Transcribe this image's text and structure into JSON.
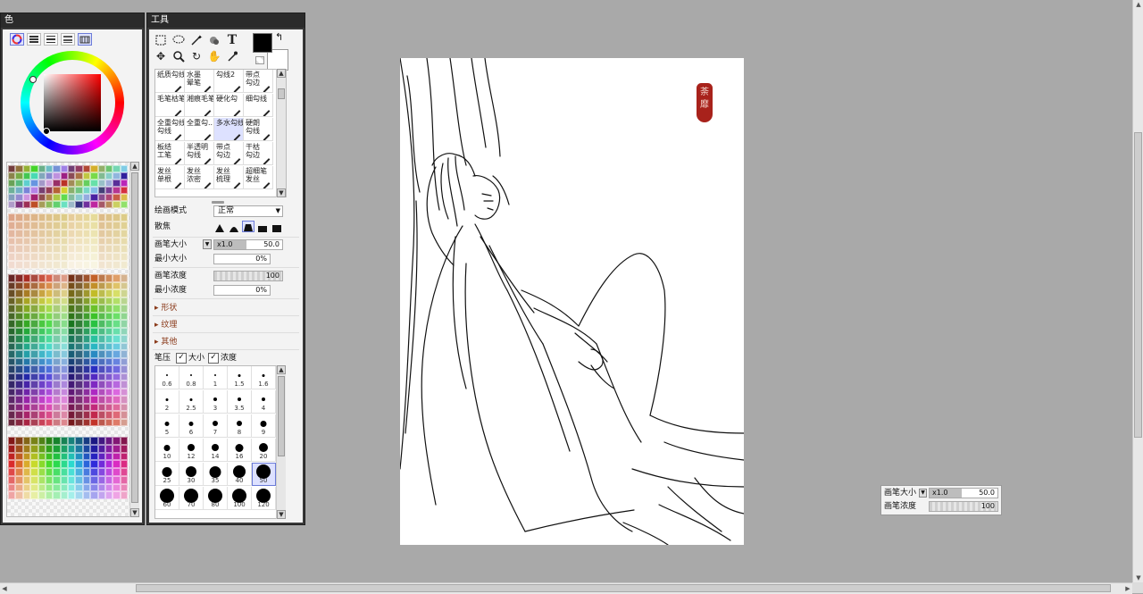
{
  "color_panel": {
    "title": "色",
    "mode_icons": [
      "color-wheel-icon",
      "rgb-slider-icon",
      "hsv-slider-icon",
      "mix-slider-icon",
      "swatch-mode-icon"
    ]
  },
  "tool_panel": {
    "title": "工具",
    "tools": [
      "rect-select-icon",
      "lasso-icon",
      "magic-wand-icon",
      "bucket-icon",
      "text-icon",
      "move-icon",
      "zoom-icon",
      "rotate-icon",
      "hand-icon",
      "eyedropper-icon"
    ],
    "brushes": [
      [
        "纸质勾线",
        "水墨\n晕笔",
        "勾线2",
        "带点\n勾边"
      ],
      [
        "毛笔枯笔",
        "湘痕毛笔",
        "硬化勾",
        "细勾线"
      ],
      [
        "全重勾线\n勾线",
        "全重勾...",
        "多水勾线",
        "硬朗\n勾线"
      ],
      [
        "板结\n工笔",
        "半透明\n勾线",
        "带点\n勾边",
        "干枯\n勾边"
      ],
      [
        "发丝\n单根",
        "发丝\n浓密",
        "发丝\n梳理",
        "超细笔\n发丝"
      ]
    ],
    "draw_mode_label": "绘画模式",
    "draw_mode_value": "正常",
    "scatter_label": "散焦",
    "brush_size_label": "画笔大小",
    "brush_size_mult": "x1.0",
    "brush_size_value": "50.0",
    "min_size_label": "最小大小",
    "min_size_value": "0%",
    "density_label": "画笔浓度",
    "density_value": "100",
    "min_density_label": "最小浓度",
    "min_density_value": "0%",
    "sections": [
      "形状",
      "纹理",
      "其他"
    ],
    "pressure_label": "笔压",
    "pressure_size_label": "大小",
    "pressure_density_label": "浓度",
    "sizes": [
      "0.6",
      "0.8",
      "1",
      "1.5",
      "1.6",
      "2",
      "2.5",
      "3",
      "3.5",
      "4",
      "5",
      "6",
      "7",
      "8",
      "9",
      "10",
      "12",
      "14",
      "16",
      "20",
      "25",
      "30",
      "35",
      "40",
      "50",
      "60",
      "70",
      "80",
      "100",
      "120"
    ],
    "selected_size": "50",
    "primary_color": "#000000",
    "secondary_color": "#ffffff"
  },
  "popup": {
    "size_label": "画笔大小",
    "size_mult": "x1.0",
    "size_value": "50.0",
    "density_label": "画笔浓度",
    "density_value": "100"
  },
  "seal_text": "荼靡"
}
